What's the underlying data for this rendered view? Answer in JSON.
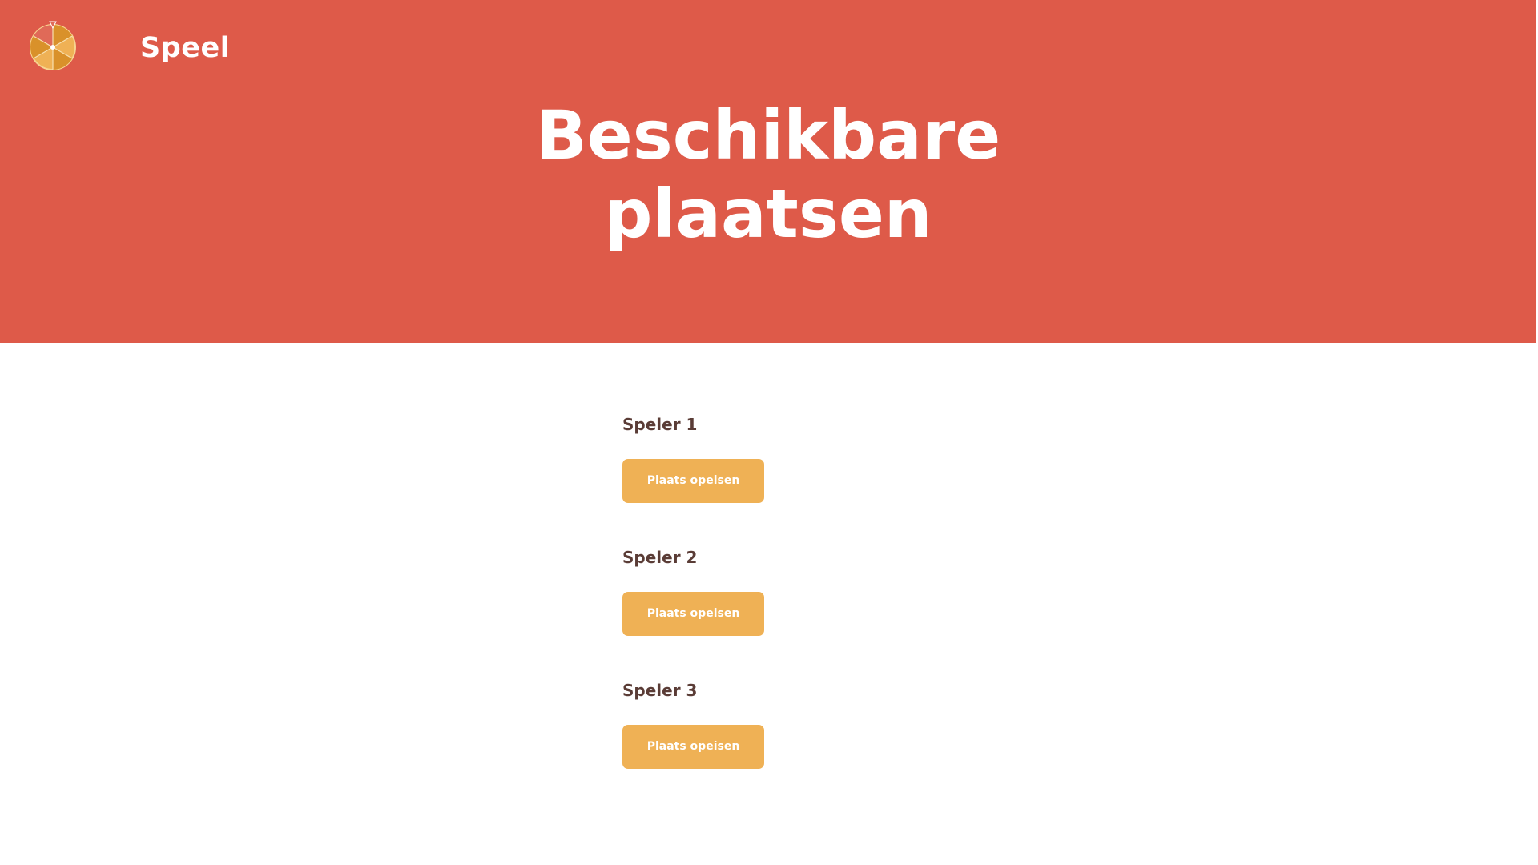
{
  "header": {
    "brand": "Speel",
    "title_line1": "Beschikbare",
    "title_line2": "plaatsen",
    "logo_icon": "prize-wheel-icon",
    "background_color": "#de5a49"
  },
  "slots": [
    {
      "label": "Speler 1",
      "button_label": "Plaats opeisen"
    },
    {
      "label": "Speler 2",
      "button_label": "Plaats opeisen"
    },
    {
      "label": "Speler 3",
      "button_label": "Plaats opeisen"
    }
  ],
  "colors": {
    "accent_button": "#efb155",
    "label_text": "#5a3c36"
  }
}
